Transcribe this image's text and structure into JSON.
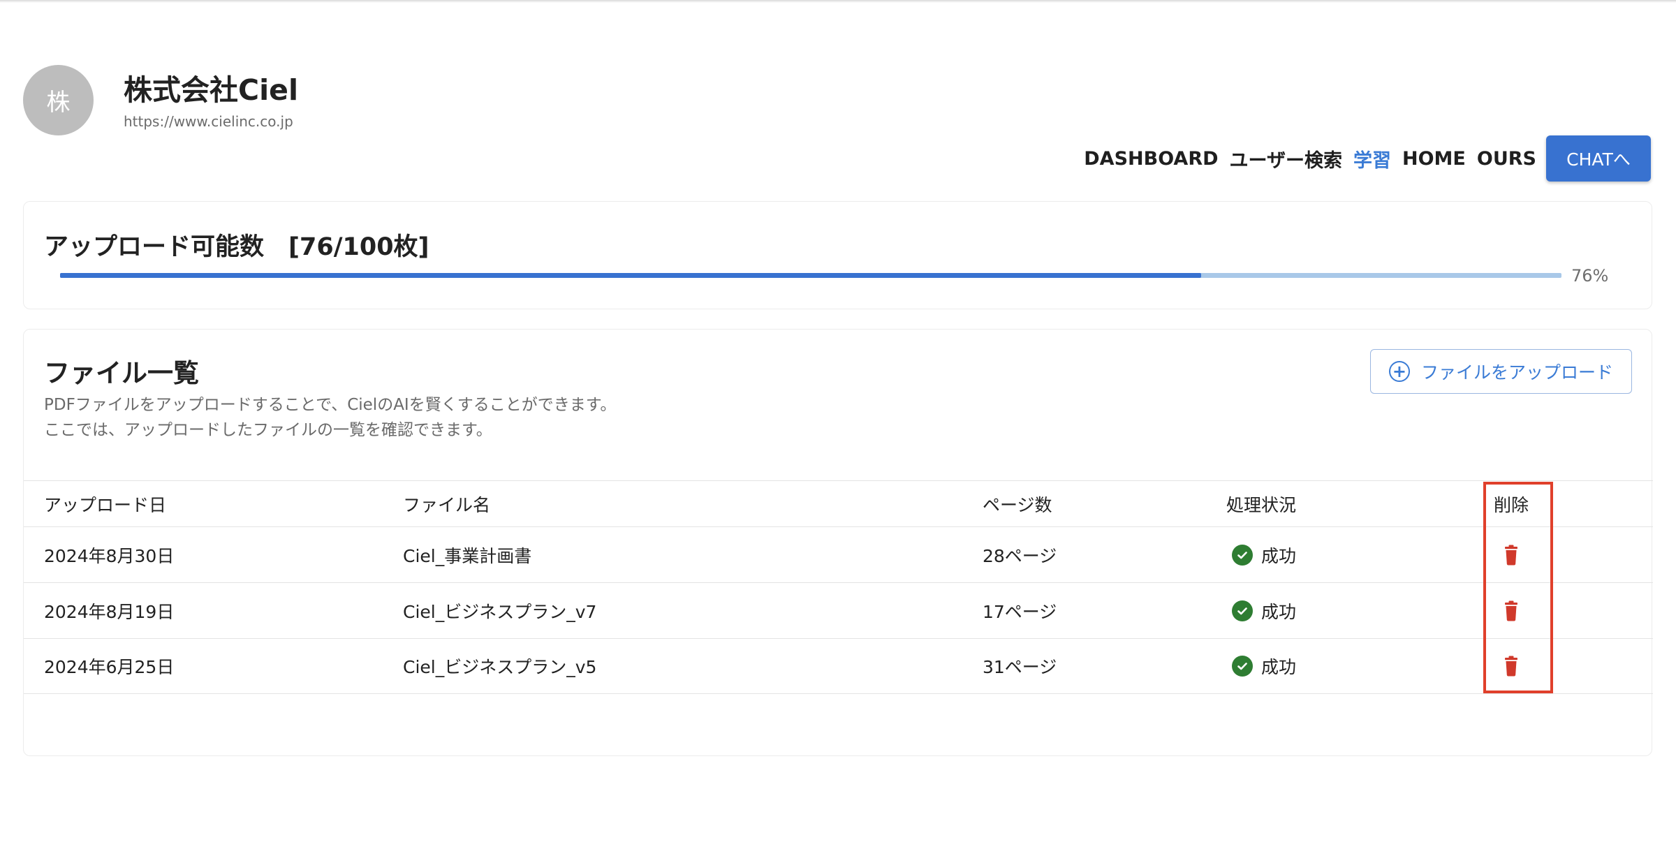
{
  "header": {
    "avatar_text": "株",
    "company_name": "株式会社Ciel",
    "company_url": "https://www.cielinc.co.jp"
  },
  "nav": {
    "items": [
      {
        "label": "DASHBOARD",
        "active": false
      },
      {
        "label": "ユーザー検索",
        "active": false
      },
      {
        "label": "学習",
        "active": true
      },
      {
        "label": "HOME",
        "active": false
      },
      {
        "label": "OURS",
        "active": false
      }
    ],
    "chat_button": "CHATへ"
  },
  "upload_quota": {
    "title": "アップロード可能数　[76/100枚]",
    "progress": 0.76,
    "progress_label": "76%"
  },
  "files": {
    "title": "ファイル一覧",
    "description_line1": "PDFファイルをアップロードすることで、CielのAIを賢くすることができます。",
    "description_line2": "ここでは、アップロードしたファイルの一覧を確認できます。",
    "upload_button": "ファイルをアップロード",
    "columns": {
      "date": "アップロード日",
      "name": "ファイル名",
      "pages": "ページ数",
      "status": "処理状況",
      "delete": "削除"
    },
    "rows": [
      {
        "date": "2024年8月30日",
        "name": "Ciel_事業計画書",
        "pages": "28ページ",
        "status": "成功"
      },
      {
        "date": "2024年8月19日",
        "name": "Ciel_ビジネスプラン_v7",
        "pages": "17ページ",
        "status": "成功"
      },
      {
        "date": "2024年6月25日",
        "name": "Ciel_ビジネスプラン_v5",
        "pages": "31ページ",
        "status": "成功"
      }
    ]
  },
  "colors": {
    "accent": "#3872d0",
    "success": "#2e7d32",
    "delete": "#d0392b",
    "highlight": "#e0402b"
  },
  "icons": {
    "upload": "plus-circle-icon",
    "status": "check-circle-icon",
    "delete": "trash-icon"
  }
}
